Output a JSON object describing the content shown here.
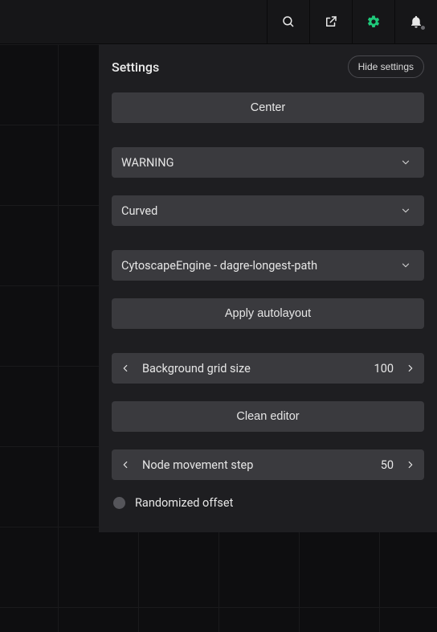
{
  "topbar": {
    "icons": [
      "search-icon",
      "external-link-icon",
      "gear-icon",
      "bell-icon"
    ],
    "activeIcon": "gear-icon"
  },
  "panel": {
    "title": "Settings",
    "hideLabel": "Hide settings",
    "centerButton": "Center",
    "logLevel": {
      "selected": "WARNING"
    },
    "edgeStyle": {
      "selected": "Curved"
    },
    "layoutEngine": {
      "selected": "CytoscapeEngine - dagre-longest-path"
    },
    "applyAutolayout": "Apply autolayout",
    "gridSize": {
      "label": "Background grid size",
      "value": "100"
    },
    "cleanEditor": "Clean editor",
    "nodeStep": {
      "label": "Node movement step",
      "value": "50"
    },
    "randomizedOffset": {
      "label": "Randomized offset",
      "checked": false
    }
  }
}
